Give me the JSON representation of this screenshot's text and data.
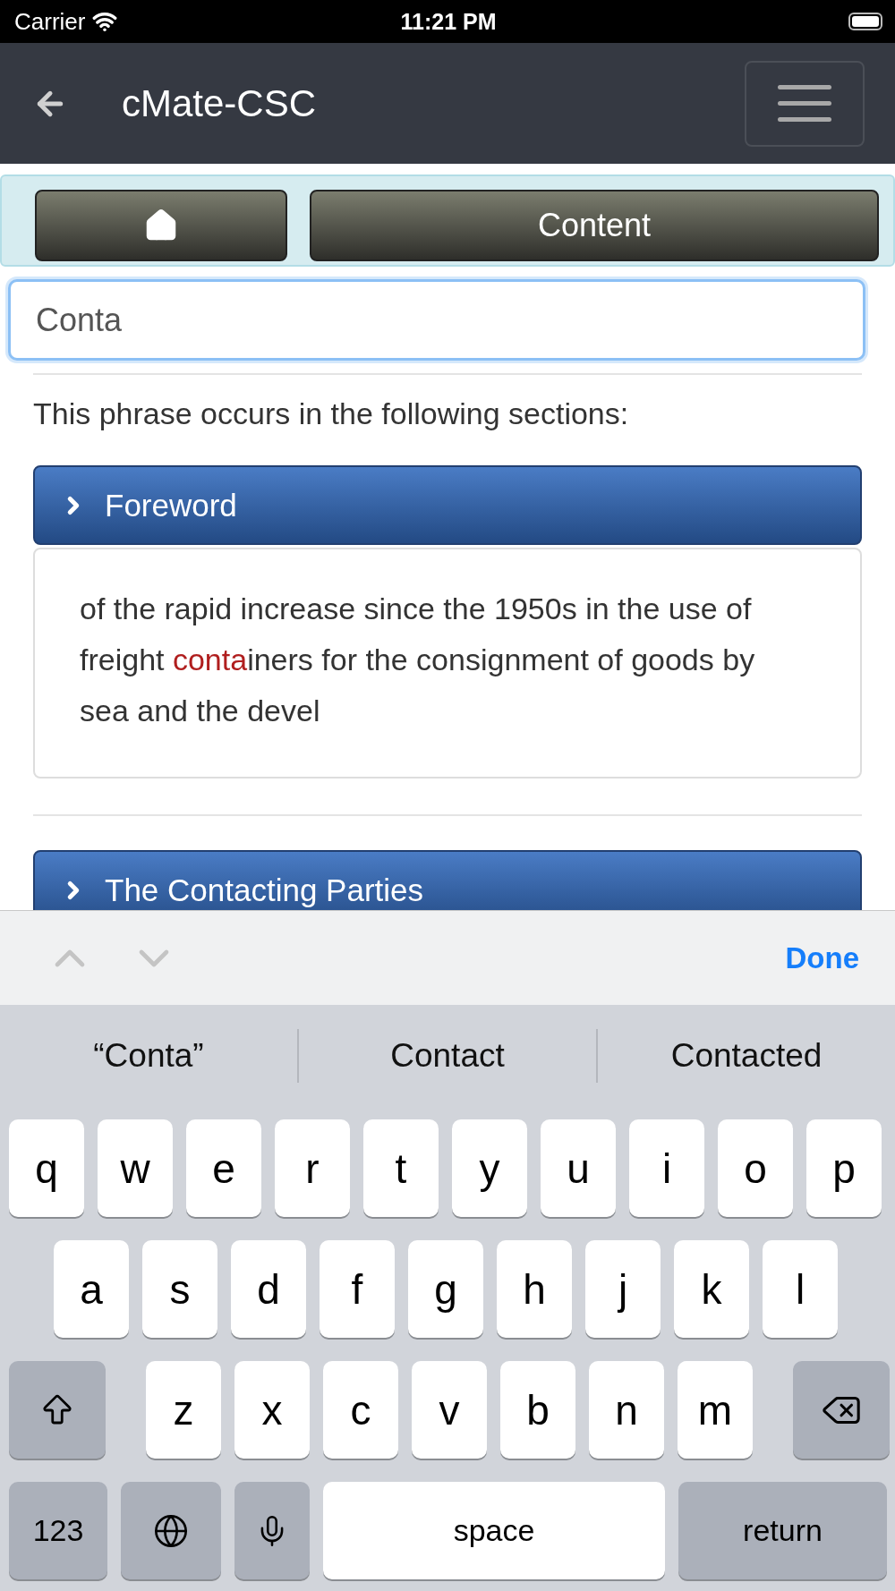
{
  "status_bar": {
    "carrier": "Carrier",
    "time": "11:21 PM"
  },
  "nav_bar": {
    "title": "cMate-CSC"
  },
  "toolbar": {
    "content_button": "Content"
  },
  "search": {
    "value": "Conta"
  },
  "results": {
    "intro": "This phrase occurs in the following sections:",
    "sections": [
      {
        "title": "Foreword",
        "snippet": {
          "before": "of the rapid increase since the 1950s in the use of freight ",
          "match": "conta",
          "after": "iners for the consignment of goods by sea and the devel"
        }
      },
      {
        "title": "The Contacting Parties"
      }
    ]
  },
  "keyboard": {
    "done": "Done",
    "suggestions": [
      "“Conta”",
      "Contact",
      "Contacted"
    ],
    "rows": [
      {
        "keys": [
          {
            "kind": "letter",
            "label": "q"
          },
          {
            "kind": "letter",
            "label": "w"
          },
          {
            "kind": "letter",
            "label": "e"
          },
          {
            "kind": "letter",
            "label": "r"
          },
          {
            "kind": "letter",
            "label": "t"
          },
          {
            "kind": "letter",
            "label": "y"
          },
          {
            "kind": "letter",
            "label": "u"
          },
          {
            "kind": "letter",
            "label": "i"
          },
          {
            "kind": "letter",
            "label": "o"
          },
          {
            "kind": "letter",
            "label": "p"
          }
        ]
      },
      {
        "keys": [
          {
            "kind": "letter",
            "label": "a"
          },
          {
            "kind": "letter",
            "label": "s"
          },
          {
            "kind": "letter",
            "label": "d"
          },
          {
            "kind": "letter",
            "label": "f"
          },
          {
            "kind": "letter",
            "label": "g"
          },
          {
            "kind": "letter",
            "label": "h"
          },
          {
            "kind": "letter",
            "label": "j"
          },
          {
            "kind": "letter",
            "label": "k"
          },
          {
            "kind": "letter",
            "label": "l"
          }
        ]
      },
      {
        "keys": [
          {
            "kind": "shift"
          },
          {
            "kind": "letter",
            "label": "z"
          },
          {
            "kind": "letter",
            "label": "x"
          },
          {
            "kind": "letter",
            "label": "c"
          },
          {
            "kind": "letter",
            "label": "v"
          },
          {
            "kind": "letter",
            "label": "b"
          },
          {
            "kind": "letter",
            "label": "n"
          },
          {
            "kind": "letter",
            "label": "m"
          },
          {
            "kind": "backspace"
          }
        ]
      },
      {
        "keys": [
          {
            "kind": "mode",
            "label": "123"
          },
          {
            "kind": "globe"
          },
          {
            "kind": "mic"
          },
          {
            "kind": "space",
            "label": "space"
          },
          {
            "kind": "return",
            "label": "return"
          }
        ]
      }
    ]
  }
}
